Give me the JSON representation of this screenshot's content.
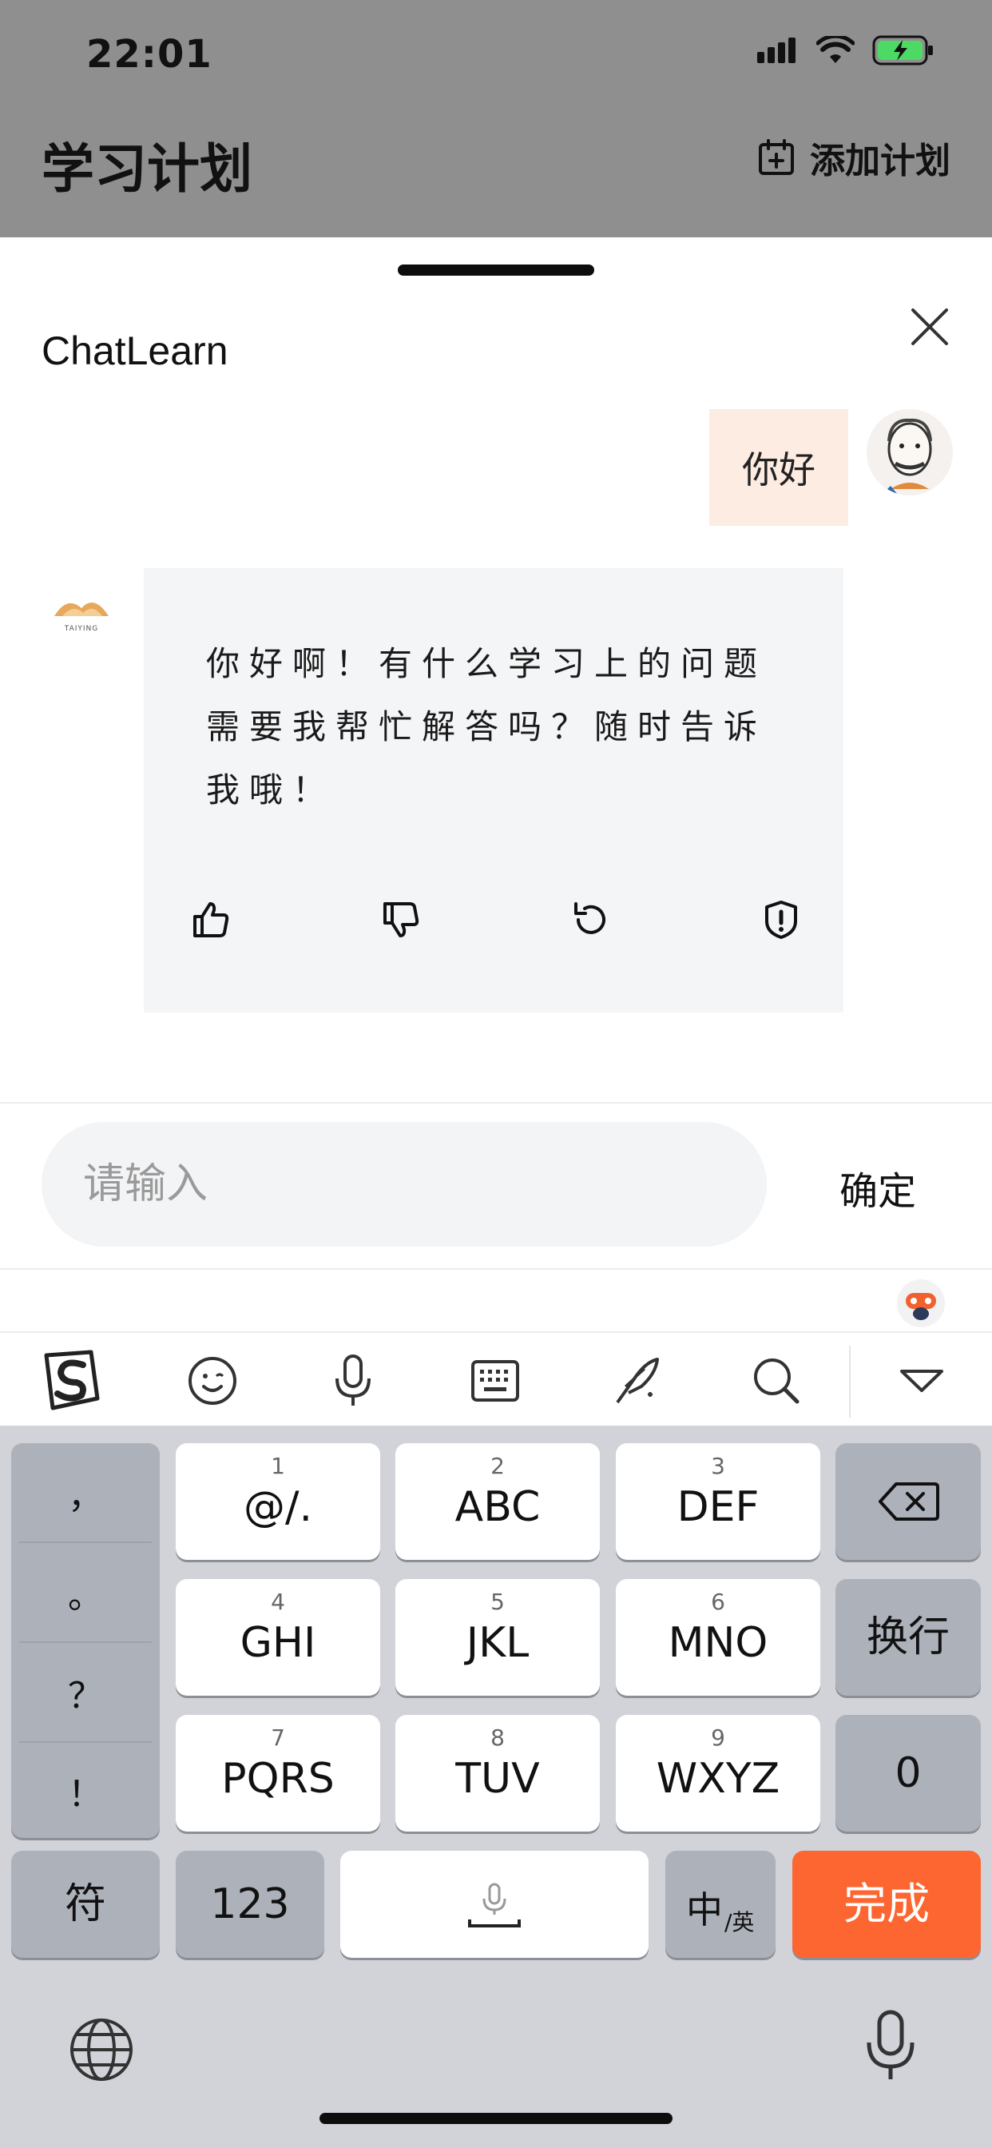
{
  "status_bar": {
    "time": "22:01"
  },
  "header": {
    "title": "学习计划",
    "add_plan_label": "添加计划"
  },
  "sheet": {
    "title": "ChatLearn"
  },
  "conversation": {
    "user_message": "你好",
    "bot_message": "你好啊！有什么学习上的问题需要我帮忙解答吗？随时告诉我哦！",
    "bot_logo_text": "TAIYING",
    "actions": [
      "thumbs-up-icon",
      "thumbs-down-icon",
      "regenerate-icon",
      "report-icon"
    ]
  },
  "input": {
    "placeholder": "请输入",
    "confirm_label": "确定"
  },
  "keyboard": {
    "punctuation": [
      "，",
      "。",
      "？",
      "！"
    ],
    "rows": [
      [
        {
          "num": "1",
          "label": "@/."
        },
        {
          "num": "2",
          "label": "ABC"
        },
        {
          "num": "3",
          "label": "DEF"
        }
      ],
      [
        {
          "num": "4",
          "label": "GHI"
        },
        {
          "num": "5",
          "label": "JKL"
        },
        {
          "num": "6",
          "label": "MNO"
        }
      ],
      [
        {
          "num": "7",
          "label": "PQRS"
        },
        {
          "num": "8",
          "label": "TUV"
        },
        {
          "num": "9",
          "label": "WXYZ"
        }
      ]
    ],
    "newline_label": "换行",
    "zero_label": "0",
    "symbols_label": "符",
    "numbers_label": "123",
    "lang_main": "中",
    "lang_sub": "/英",
    "done_label": "完成",
    "done_color": "#fd6631"
  },
  "colors": {
    "accent": "#fd6631",
    "user_bubble": "#fdece1",
    "bot_card": "#f4f5f7"
  }
}
